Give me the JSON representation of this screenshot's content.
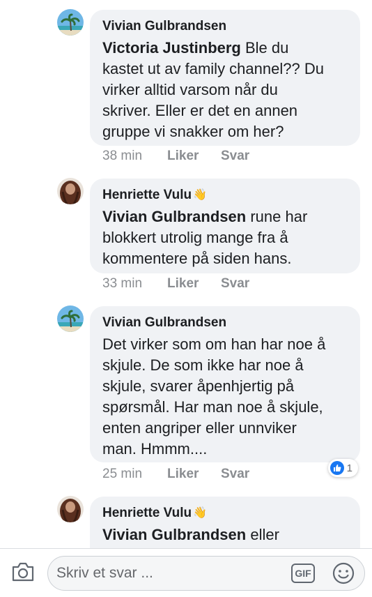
{
  "comments": [
    {
      "author": "Vivian Gulbrandsen",
      "lines": [
        {
          "mention": "Victoria Justinberg",
          "text": " Ble du"
        },
        {
          "mention": "",
          "text": "kastet ut av family channel?? Du"
        },
        {
          "mention": "",
          "text": "virker alltid varsom når du"
        },
        {
          "mention": "",
          "text": "skriver. Eller er det en annen"
        },
        {
          "mention": "",
          "text": "gruppe vi snakker om her?"
        }
      ],
      "time": "38 min",
      "like": "Liker",
      "reply": "Svar"
    },
    {
      "author": "Henriette Vulu",
      "badge": "👋",
      "lines": [
        {
          "mention": "Vivian Gulbrandsen",
          "text": " rune har"
        },
        {
          "mention": "",
          "text": "blokkert utrolig mange fra å"
        },
        {
          "mention": "",
          "text": "kommentere på siden hans."
        }
      ],
      "time": "33 min",
      "like": "Liker",
      "reply": "Svar"
    },
    {
      "author": "Vivian Gulbrandsen",
      "lines": [
        {
          "mention": "",
          "text": "Det virker som om han har noe å"
        },
        {
          "mention": "",
          "text": "skjule. De som ikke har noe å"
        },
        {
          "mention": "",
          "text": "skjule, svarer åpenhjertig på"
        },
        {
          "mention": "",
          "text": "spørsmål. Har man noe å skjule,"
        },
        {
          "mention": "",
          "text": "enten angriper eller unnviker"
        },
        {
          "mention": "",
          "text": "man. Hmmm...."
        }
      ],
      "time": "25 min",
      "like": "Liker",
      "reply": "Svar",
      "reaction_count": "1"
    },
    {
      "author": "Henriette Vulu",
      "badge": "👋",
      "lines": [
        {
          "mention": "Vivian Gulbrandsen",
          "text": " eller"
        }
      ]
    }
  ],
  "composer": {
    "placeholder": "Skriv et svar ...",
    "gif_label": "GIF",
    "camera_icon": "camera-icon",
    "emoji_icon": "smiley-icon"
  },
  "colors": {
    "bubble": "#f0f2f5",
    "like_blue": "#1877f2",
    "meta_gray": "#8a8d91"
  }
}
